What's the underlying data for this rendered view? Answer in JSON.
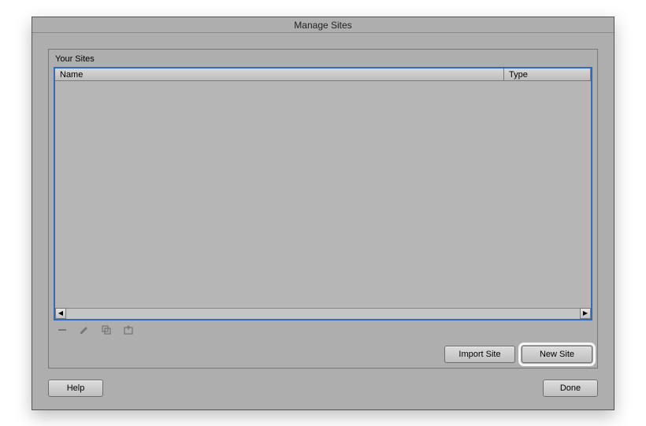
{
  "title": "Manage Sites",
  "group_title": "Your Sites",
  "columns": {
    "name": "Name",
    "type": "Type"
  },
  "buttons": {
    "import": "Import Site",
    "newsite": "New Site",
    "help": "Help",
    "done": "Done"
  }
}
